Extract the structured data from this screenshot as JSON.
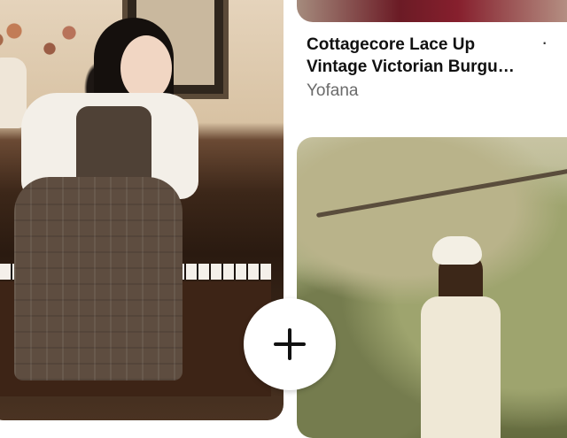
{
  "feed": {
    "pin_top": {
      "title_lines": [
        "Cottagecore Lace Up",
        "Vintage Victorian Burgu…"
      ],
      "brand": "Yofana"
    },
    "plus_button": {
      "icon": "plus-icon"
    },
    "more_icon": "more-icon"
  }
}
